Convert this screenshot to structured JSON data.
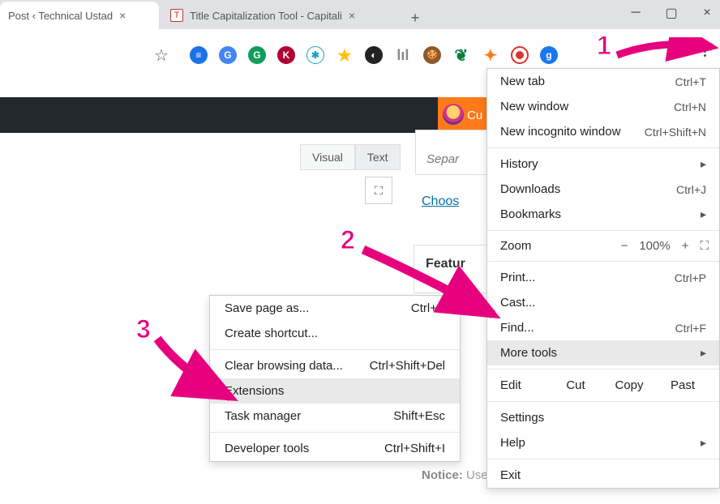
{
  "tabs": {
    "t1": "Post ‹ Technical Ustad",
    "t2": "Title Capitalization Tool - Capitali"
  },
  "page": {
    "cu": "Cu",
    "visual": "Visual",
    "text": "Text",
    "separ": "Separ",
    "choose": "Choos",
    "featur": "Featur",
    "notice_b": "Notice:",
    "notice": " Use only with those post templates:"
  },
  "menu": {
    "new_tab": "New tab",
    "new_tab_sc": "Ctrl+T",
    "new_window": "New window",
    "new_window_sc": "Ctrl+N",
    "incognito": "New incognito window",
    "incognito_sc": "Ctrl+Shift+N",
    "history": "History",
    "downloads": "Downloads",
    "downloads_sc": "Ctrl+J",
    "bookmarks": "Bookmarks",
    "zoom": "Zoom",
    "zoom_minus": "−",
    "zoom_val": "100%",
    "zoom_plus": "+",
    "print": "Print...",
    "print_sc": "Ctrl+P",
    "cast": "Cast...",
    "find": "Find...",
    "find_sc": "Ctrl+F",
    "more_tools": "More tools",
    "edit": "Edit",
    "cut": "Cut",
    "copy": "Copy",
    "paste": "Past",
    "settings": "Settings",
    "help": "Help",
    "exit": "Exit"
  },
  "submenu": {
    "save_page": "Save page as...",
    "save_page_sc": "Ctrl+S",
    "shortcut": "Create shortcut...",
    "clear": "Clear browsing data...",
    "clear_sc": "Ctrl+Shift+Del",
    "extensions": "Extensions",
    "task": "Task manager",
    "task_sc": "Shift+Esc",
    "dev": "Developer tools",
    "dev_sc": "Ctrl+Shift+I"
  },
  "annot": {
    "n1": "1",
    "n2": "2",
    "n3": "3"
  }
}
